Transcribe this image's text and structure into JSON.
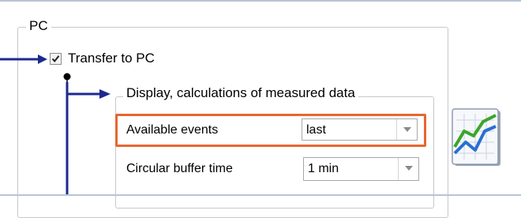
{
  "groups": {
    "pc": {
      "title": "PC"
    },
    "display": {
      "title": "Display, calculations of measured data"
    }
  },
  "transfer": {
    "label": "Transfer to PC",
    "checked": true
  },
  "settings": [
    {
      "label": "Available events",
      "value": "last",
      "highlighted": true
    },
    {
      "label": "Circular buffer time",
      "value": "1 min",
      "highlighted": false
    }
  ],
  "icons": {
    "checkmark": "check-icon",
    "dropdown": "chevron-down-icon",
    "chart": "line-chart-icon"
  },
  "colors": {
    "connector": "#1c2a8f",
    "highlight": "#e8662f",
    "group_border": "#c8c8c8"
  }
}
